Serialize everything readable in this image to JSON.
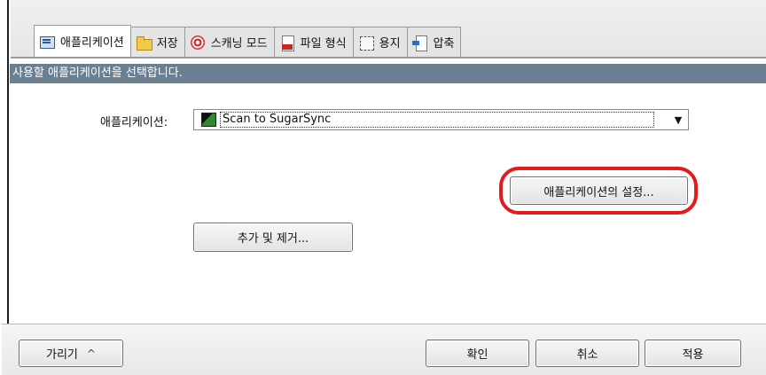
{
  "tabs": [
    {
      "label": "애플리케이션",
      "icon": "application-icon",
      "active": true
    },
    {
      "label": "저장",
      "icon": "folder-icon",
      "active": false
    },
    {
      "label": "스캐닝 모드",
      "icon": "scan-mode-icon",
      "active": false
    },
    {
      "label": "파일 형식",
      "icon": "file-format-icon",
      "active": false
    },
    {
      "label": "용지",
      "icon": "paper-icon",
      "active": false
    },
    {
      "label": "압축",
      "icon": "compression-icon",
      "active": false
    }
  ],
  "prompt": "사용할 애플리케이션을 선택합니다.",
  "application": {
    "label": "애플리케이션:",
    "selected": "Scan to SugarSync",
    "dropdown_arrow": "▼"
  },
  "buttons": {
    "settings": "애플리케이션의 설정...",
    "add_remove": "추가 및 제거...",
    "hide": "가리기",
    "hide_chevron": "^",
    "ok": "확인",
    "cancel": "취소",
    "apply": "적용"
  },
  "colors": {
    "prompt_bar": "#6a7f92",
    "highlight": "#e21b1b"
  }
}
